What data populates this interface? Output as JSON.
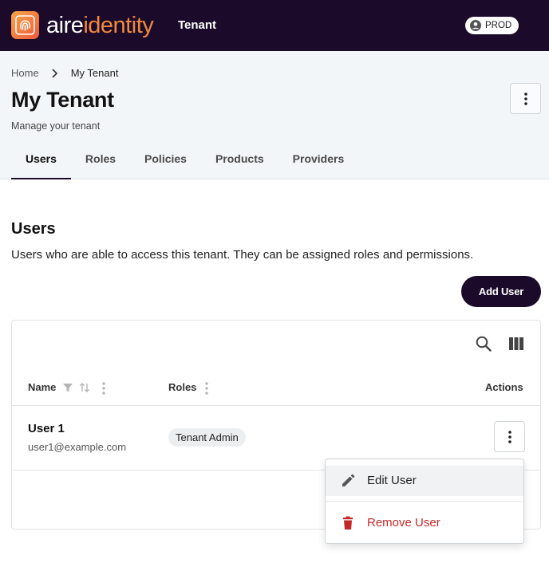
{
  "topbar": {
    "logo_aire": "aire",
    "logo_identity": "identity",
    "section": "Tenant",
    "environment": "PROD"
  },
  "breadcrumb": {
    "home": "Home",
    "current": "My Tenant"
  },
  "page": {
    "title": "My Tenant",
    "subtitle": "Manage your tenant"
  },
  "tabs": [
    {
      "label": "Users",
      "active": true
    },
    {
      "label": "Roles",
      "active": false
    },
    {
      "label": "Policies",
      "active": false
    },
    {
      "label": "Products",
      "active": false
    },
    {
      "label": "Providers",
      "active": false
    }
  ],
  "users_section": {
    "title": "Users",
    "description": "Users who are able to access this tenant. They can be assigned roles and permissions.",
    "add_button": "Add User"
  },
  "table": {
    "columns": {
      "name": "Name",
      "roles": "Roles",
      "actions": "Actions"
    },
    "rows": [
      {
        "name": "User 1",
        "email": "user1@example.com",
        "role": "Tenant Admin"
      }
    ]
  },
  "row_menu": {
    "edit": "Edit User",
    "remove": "Remove User"
  },
  "colors": {
    "brand_dark": "#1b0a2a",
    "brand_orange": "#f08a3c",
    "danger": "#c62828"
  }
}
